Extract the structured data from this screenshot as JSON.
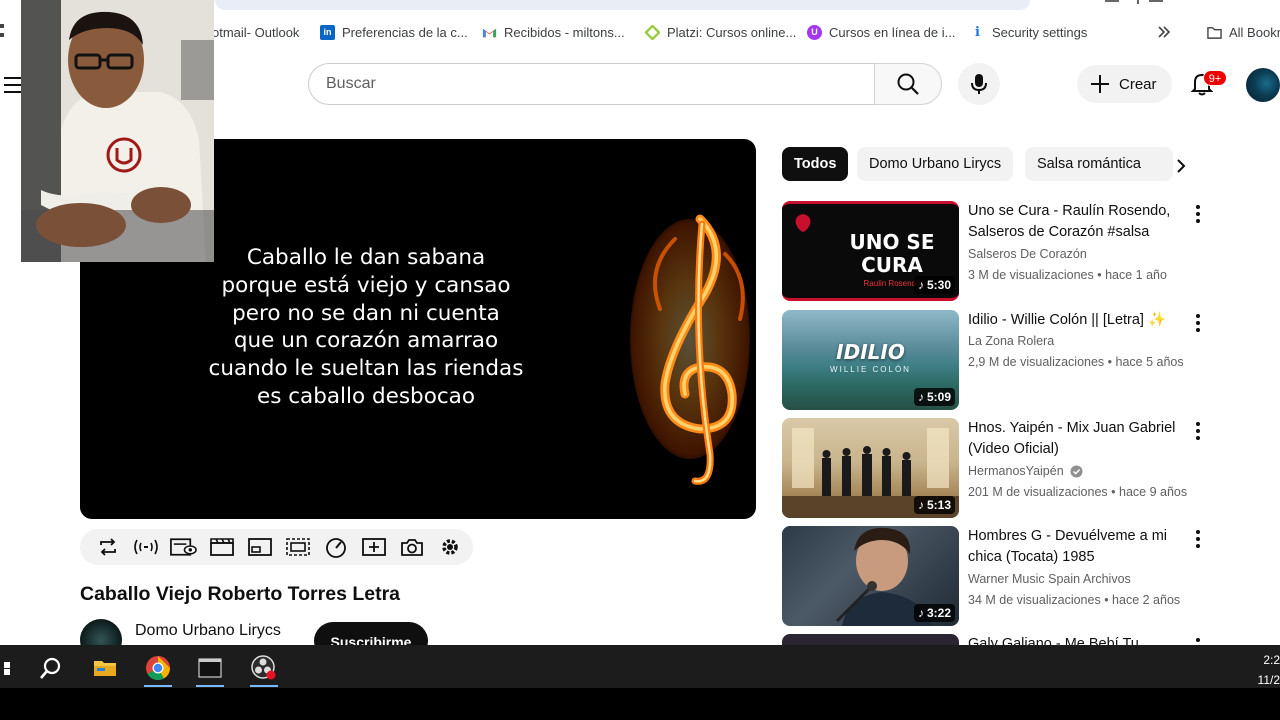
{
  "browser": {
    "bookmarks": [
      {
        "label": "otmail- Outlook",
        "icon": "outlook-icon"
      },
      {
        "label": "Preferencias de la c...",
        "icon": "linkedin-icon"
      },
      {
        "label": "Recibidos - miltons...",
        "icon": "gmail-icon"
      },
      {
        "label": "Platzi: Cursos online...",
        "icon": "platzi-icon"
      },
      {
        "label": "Cursos en línea de i...",
        "icon": "udemy-icon"
      },
      {
        "label": "Security settings",
        "icon": "info-icon"
      }
    ],
    "all_bookmarks": "All Bookm"
  },
  "header": {
    "search_placeholder": "Buscar",
    "create_label": "Crear",
    "notifications_badge": "9+"
  },
  "player": {
    "lyrics": [
      "Caballo le dan sabana",
      "porque está viejo y cansao",
      "pero no se dan ni cuenta",
      "que un corazón amarrao",
      "cuando le sueltan las riendas",
      "es caballo desbocao"
    ]
  },
  "video": {
    "title": "Caballo Viejo Roberto Torres Letra",
    "channel": "Domo Urbano Lirycs",
    "subscribe_label": "Suscribirme"
  },
  "chips": [
    "Todos",
    "Domo Urbano Lirycs",
    "Salsa romántica"
  ],
  "recommendations": [
    {
      "title": "Uno se Cura - Raulín Rosendo, Salseros de Corazón #salsa",
      "channel": "Salseros De Corazón",
      "views": "3 M de visualizaciones",
      "age": "hace 1 año",
      "duration": "5:30",
      "thumb_text": "UNO SE CURA",
      "thumb_sub": "Raulin Rosendo",
      "verified": false
    },
    {
      "title": "Idilio - Willie Colón || [Letra] ✨",
      "channel": "La Zona Rolera",
      "views": "2,9 M de visualizaciones",
      "age": "hace 5 años",
      "duration": "5:09",
      "thumb_text": "IDILIO",
      "thumb_sub": "WILLIE COLÓN",
      "verified": false
    },
    {
      "title": "Hnos. Yaipén - Mix Juan Gabriel (Video Oficial)",
      "channel": "HermanosYaipén",
      "views": "201 M de visualizaciones",
      "age": "hace 9 años",
      "duration": "5:13",
      "verified": true
    },
    {
      "title": "Hombres G - Devuélveme a mi chica (Tocata) 1985",
      "channel": "Warner Music Spain Archivos",
      "views": "34 M de visualizaciones",
      "age": "hace 2 años",
      "duration": "3:22",
      "verified": false
    },
    {
      "title": "Galy Galiano - Me Bebí Tu",
      "verified": false
    }
  ],
  "taskbar": {
    "clock_time": "2:2",
    "clock_date": "11/2"
  }
}
